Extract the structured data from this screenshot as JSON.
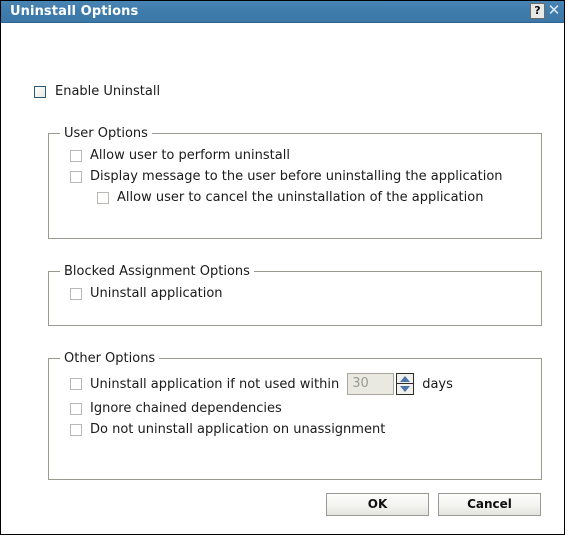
{
  "window": {
    "title": "Uninstall Options",
    "help_button": "?",
    "close_button": "✕"
  },
  "enable": {
    "label": "Enable Uninstall",
    "checked": false,
    "state": "enabled"
  },
  "groups": [
    {
      "id": "user",
      "legend": "User Options",
      "options": [
        {
          "label": "Allow user to perform uninstall",
          "checked": false,
          "state": "disabled",
          "indent": false
        },
        {
          "label": "Display message to the user before uninstalling the application",
          "checked": false,
          "state": "disabled",
          "indent": false
        },
        {
          "label": "Allow user to cancel the uninstallation of the application",
          "checked": false,
          "state": "disabled",
          "indent": true
        }
      ]
    },
    {
      "id": "blocked",
      "legend": "Blocked Assignment Options",
      "options": [
        {
          "label": "Uninstall application",
          "checked": false,
          "state": "disabled",
          "indent": false
        }
      ]
    },
    {
      "id": "other",
      "legend": "Other Options",
      "options": [
        {
          "label": "Uninstall application if not used within",
          "checked": false,
          "state": "disabled",
          "indent": false
        },
        {
          "label": "Ignore chained dependencies",
          "checked": false,
          "state": "disabled",
          "indent": false
        },
        {
          "label": "Do not uninstall application on unassignment",
          "checked": false,
          "state": "disabled",
          "indent": false
        }
      ]
    }
  ],
  "spinner": {
    "value": "30",
    "state": "disabled",
    "unit_label": "days",
    "up_icon": "spinner-up-arrow-icon",
    "down_icon": "spinner-down-arrow-icon"
  },
  "footer": {
    "ok_label": "OK",
    "cancel_label": "Cancel"
  },
  "colors": {
    "titlebar": "#3f7cac",
    "titlebar_text": "#ffffff",
    "group_border": "#9a9a90",
    "checkbox_enabled_border": "#2d5a74",
    "checkbox_disabled_border": "#b9b9b4",
    "spinner_arrow": "#4a76a8",
    "dialog_background": "#ffffff"
  }
}
